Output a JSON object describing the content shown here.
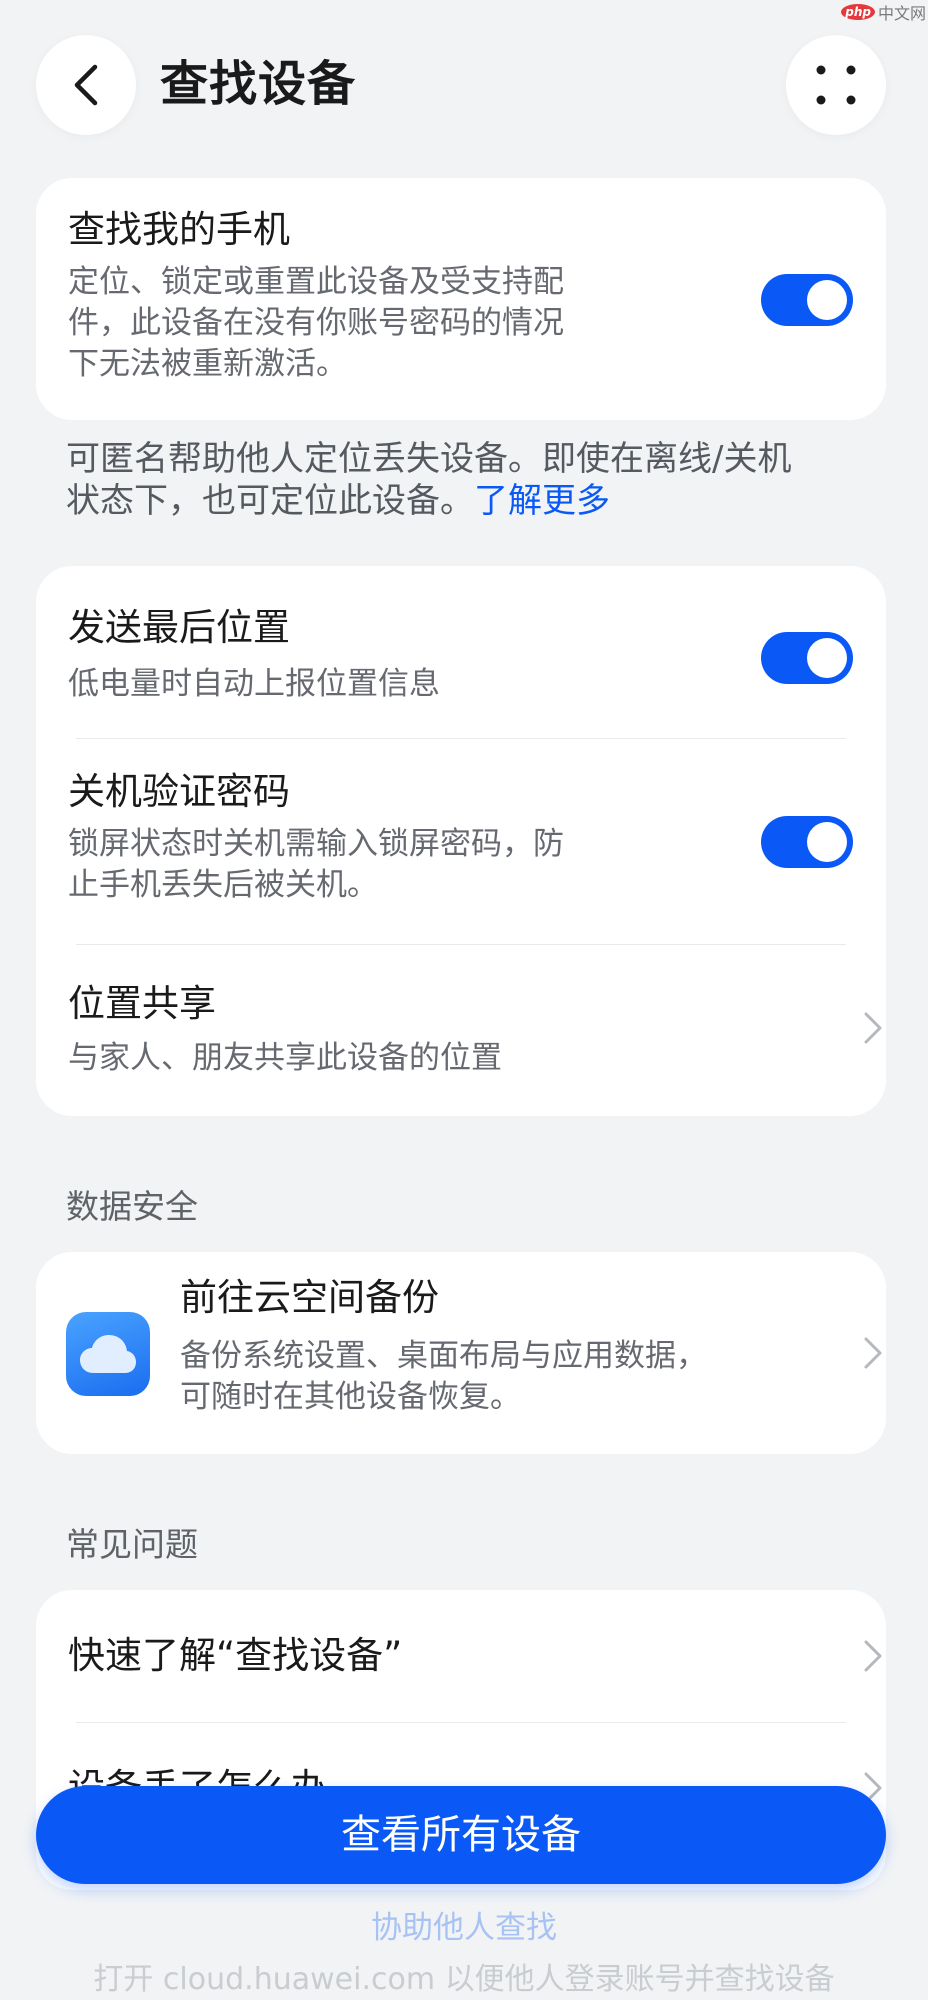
{
  "header": {
    "title": "查找设备",
    "back_icon": "chevron-left-icon",
    "menu_icon": "four-dots-icon"
  },
  "watermark": {
    "badge": "php",
    "text": "中文网"
  },
  "find_phone": {
    "title": "查找我的手机",
    "description_lines": [
      "定位、锁定或重置此设备及受支持配",
      "件，此设备在没有你账号密码的情况",
      "下无法被重新激活。"
    ],
    "enabled": true
  },
  "note": {
    "line1": "可匿名帮助他人定位丢失设备。即使在离线/关机",
    "line2": "状态下，也可定位此设备。",
    "link": "了解更多"
  },
  "settings": {
    "send_last_location": {
      "title": "发送最后位置",
      "subtitle": "低电量时自动上报位置信息",
      "enabled": true
    },
    "shutdown_password": {
      "title": "关机验证密码",
      "subtitle_lines": [
        "锁屏状态时关机需输入锁屏密码，防",
        "止手机丢失后被关机。"
      ],
      "enabled": true
    },
    "location_sharing": {
      "title": "位置共享",
      "subtitle": "与家人、朋友共享此设备的位置"
    }
  },
  "data_security": {
    "label": "数据安全",
    "cloud_backup": {
      "title": "前往云空间备份",
      "subtitle_lines": [
        "备份系统设置、桌面布局与应用数据，",
        "可随时在其他设备恢复。"
      ],
      "icon": "cloud-icon"
    }
  },
  "faq": {
    "label": "常见问题",
    "items": [
      "快速了解“查找设备”",
      "设备丢了怎么办"
    ]
  },
  "actions": {
    "view_all": "查看所有设备",
    "help_others": "协助他人查找",
    "footer": "打开 cloud.huawei.com 以便他人登录账号并查找设备"
  },
  "colors": {
    "accent": "#0a59f7",
    "background": "#f1f3f5",
    "card": "#ffffff"
  }
}
